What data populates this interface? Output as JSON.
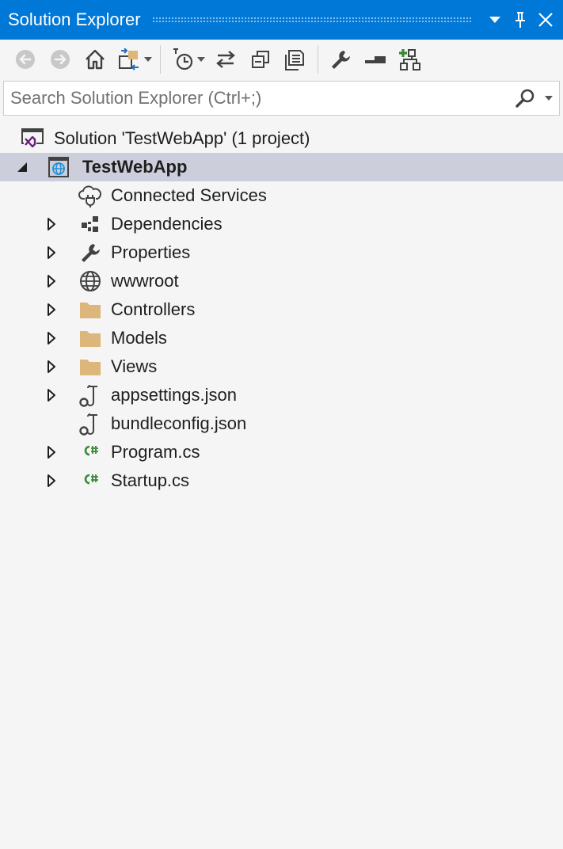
{
  "window": {
    "title": "Solution Explorer"
  },
  "toolbar": {
    "buttons": [
      "back-icon",
      "forward-icon",
      "home-icon",
      "switch-views-icon",
      "pending-changes-filter-icon",
      "sync-with-active-document-icon",
      "collapse-all-icon",
      "show-all-files-icon",
      "properties-icon",
      "preview-icon",
      "view-class-diagram-icon"
    ]
  },
  "search": {
    "placeholder": "Search Solution Explorer (Ctrl+;)",
    "value": ""
  },
  "tree": {
    "solution": "Solution 'TestWebApp' (1 project)",
    "project": "TestWebApp",
    "items": [
      {
        "label": "Connected Services",
        "icon": "connected-services-icon",
        "expandable": false
      },
      {
        "label": "Dependencies",
        "icon": "dependencies-icon",
        "expandable": true
      },
      {
        "label": "Properties",
        "icon": "wrench-icon",
        "expandable": true
      },
      {
        "label": "wwwroot",
        "icon": "globe-icon",
        "expandable": true
      },
      {
        "label": "Controllers",
        "icon": "folder-icon",
        "expandable": true
      },
      {
        "label": "Models",
        "icon": "folder-icon",
        "expandable": true
      },
      {
        "label": "Views",
        "icon": "folder-icon",
        "expandable": true
      },
      {
        "label": "appsettings.json",
        "icon": "json-file-icon",
        "expandable": true
      },
      {
        "label": "bundleconfig.json",
        "icon": "json-file-icon",
        "expandable": false
      },
      {
        "label": "Program.cs",
        "icon": "csharp-file-icon",
        "expandable": true
      },
      {
        "label": "Startup.cs",
        "icon": "csharp-file-icon",
        "expandable": true
      }
    ]
  },
  "colors": {
    "titlebar": "#0078d7",
    "selection": "#cccedb",
    "folder": "#dcb67a",
    "csharp": "#388a34",
    "vs_purple": "#68217a"
  }
}
